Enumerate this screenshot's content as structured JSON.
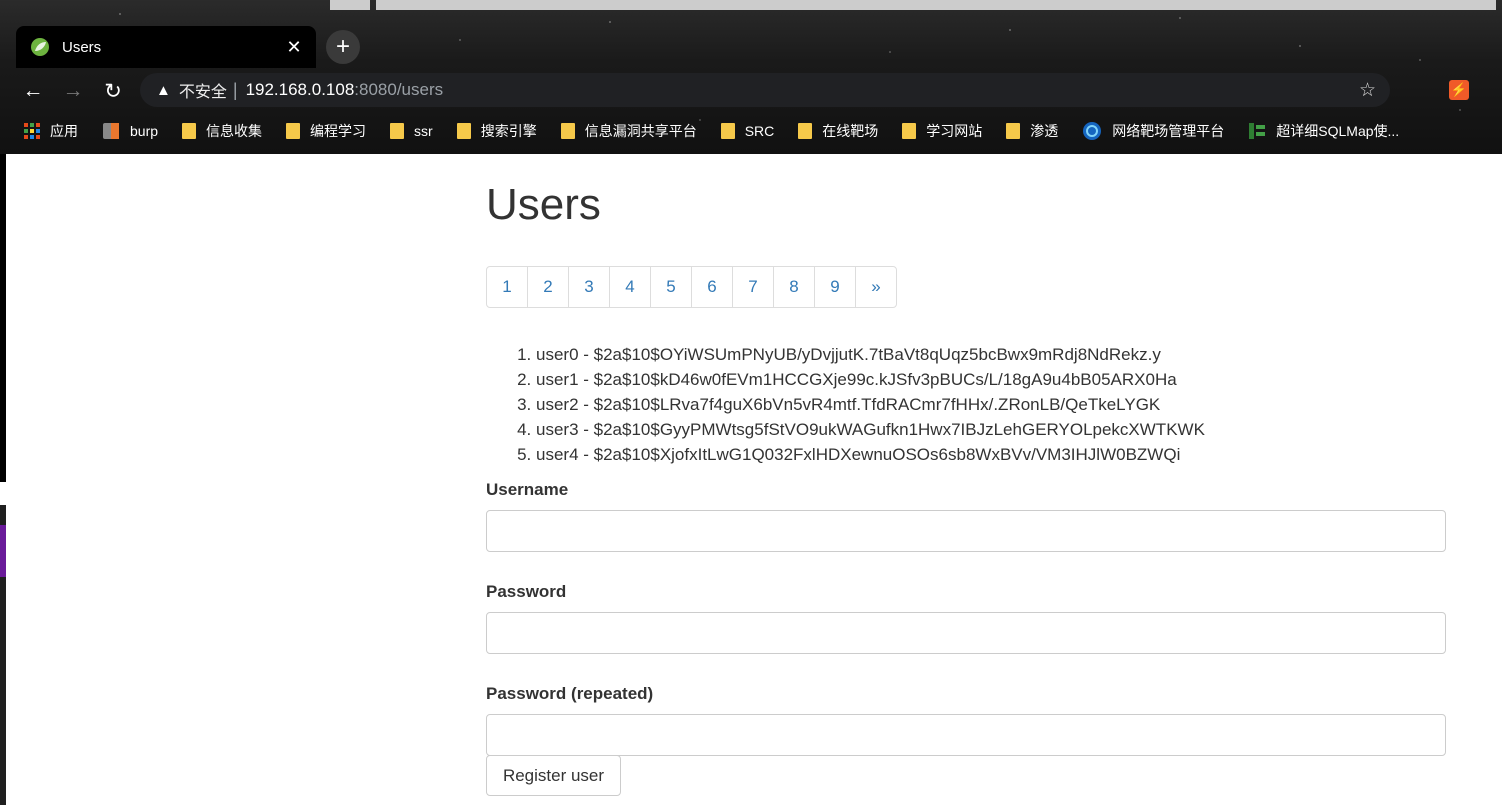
{
  "browser": {
    "tab_title": "Users",
    "tab_close": "✕",
    "new_tab": "+",
    "nav": {
      "back": "←",
      "forward": "→",
      "reload": "↻"
    },
    "address": {
      "warning_icon": "▲",
      "security_text": "不安全",
      "separator": "|",
      "host": "192.168.0.108",
      "rest": ":8080/users"
    },
    "star": "☆",
    "extension_label": "⚡",
    "bookmarks": [
      {
        "label": "应用",
        "icon": "apps-grid-icon"
      },
      {
        "label": "burp",
        "icon": "burp-icon"
      },
      {
        "label": "信息收集",
        "icon": "folder-icon"
      },
      {
        "label": "编程学习",
        "icon": "folder-icon"
      },
      {
        "label": "ssr",
        "icon": "folder-icon"
      },
      {
        "label": "搜索引擎",
        "icon": "folder-icon"
      },
      {
        "label": "信息漏洞共享平台",
        "icon": "folder-icon"
      },
      {
        "label": "SRC",
        "icon": "folder-icon"
      },
      {
        "label": "在线靶场",
        "icon": "folder-icon"
      },
      {
        "label": "学习网站",
        "icon": "folder-icon"
      },
      {
        "label": "渗透",
        "icon": "folder-icon"
      },
      {
        "label": "网络靶场管理平台",
        "icon": "globe-icon"
      },
      {
        "label": "超详细SQLMap使...",
        "icon": "doc-icon"
      }
    ]
  },
  "page": {
    "title": "Users",
    "pagination": [
      "1",
      "2",
      "3",
      "4",
      "5",
      "6",
      "7",
      "8",
      "9",
      "»"
    ],
    "users": [
      "user0 - $2a$10$OYiWSUmPNyUB/yDvjjutK.7tBaVt8qUqz5bcBwx9mRdj8NdRekz.y",
      "user1 - $2a$10$kD46w0fEVm1HCCGXje99c.kJSfv3pBUCs/L/18gA9u4bB05ARX0Ha",
      "user2 - $2a$10$LRva7f4guX6bVn5vR4mtf.TfdRACmr7fHHx/.ZRonLB/QeTkeLYGK",
      "user3 - $2a$10$GyyPMWtsg5fStVO9ukWAGufkn1Hwx7IBJzLehGERYOLpekcXWTKWK",
      "user4 - $2a$10$XjofxItLwG1Q032FxlHDXewnuOSOs6sb8WxBVv/VM3IHJlW0BZWQi"
    ],
    "form": {
      "username_label": "Username",
      "username_value": "",
      "password_label": "Password",
      "password_value": "",
      "password_repeated_label": "Password (repeated)",
      "password_repeated_value": "",
      "submit_label": "Register user"
    }
  },
  "colors": {
    "link": "#337ab7",
    "text": "#333333",
    "border": "#cccccc"
  }
}
